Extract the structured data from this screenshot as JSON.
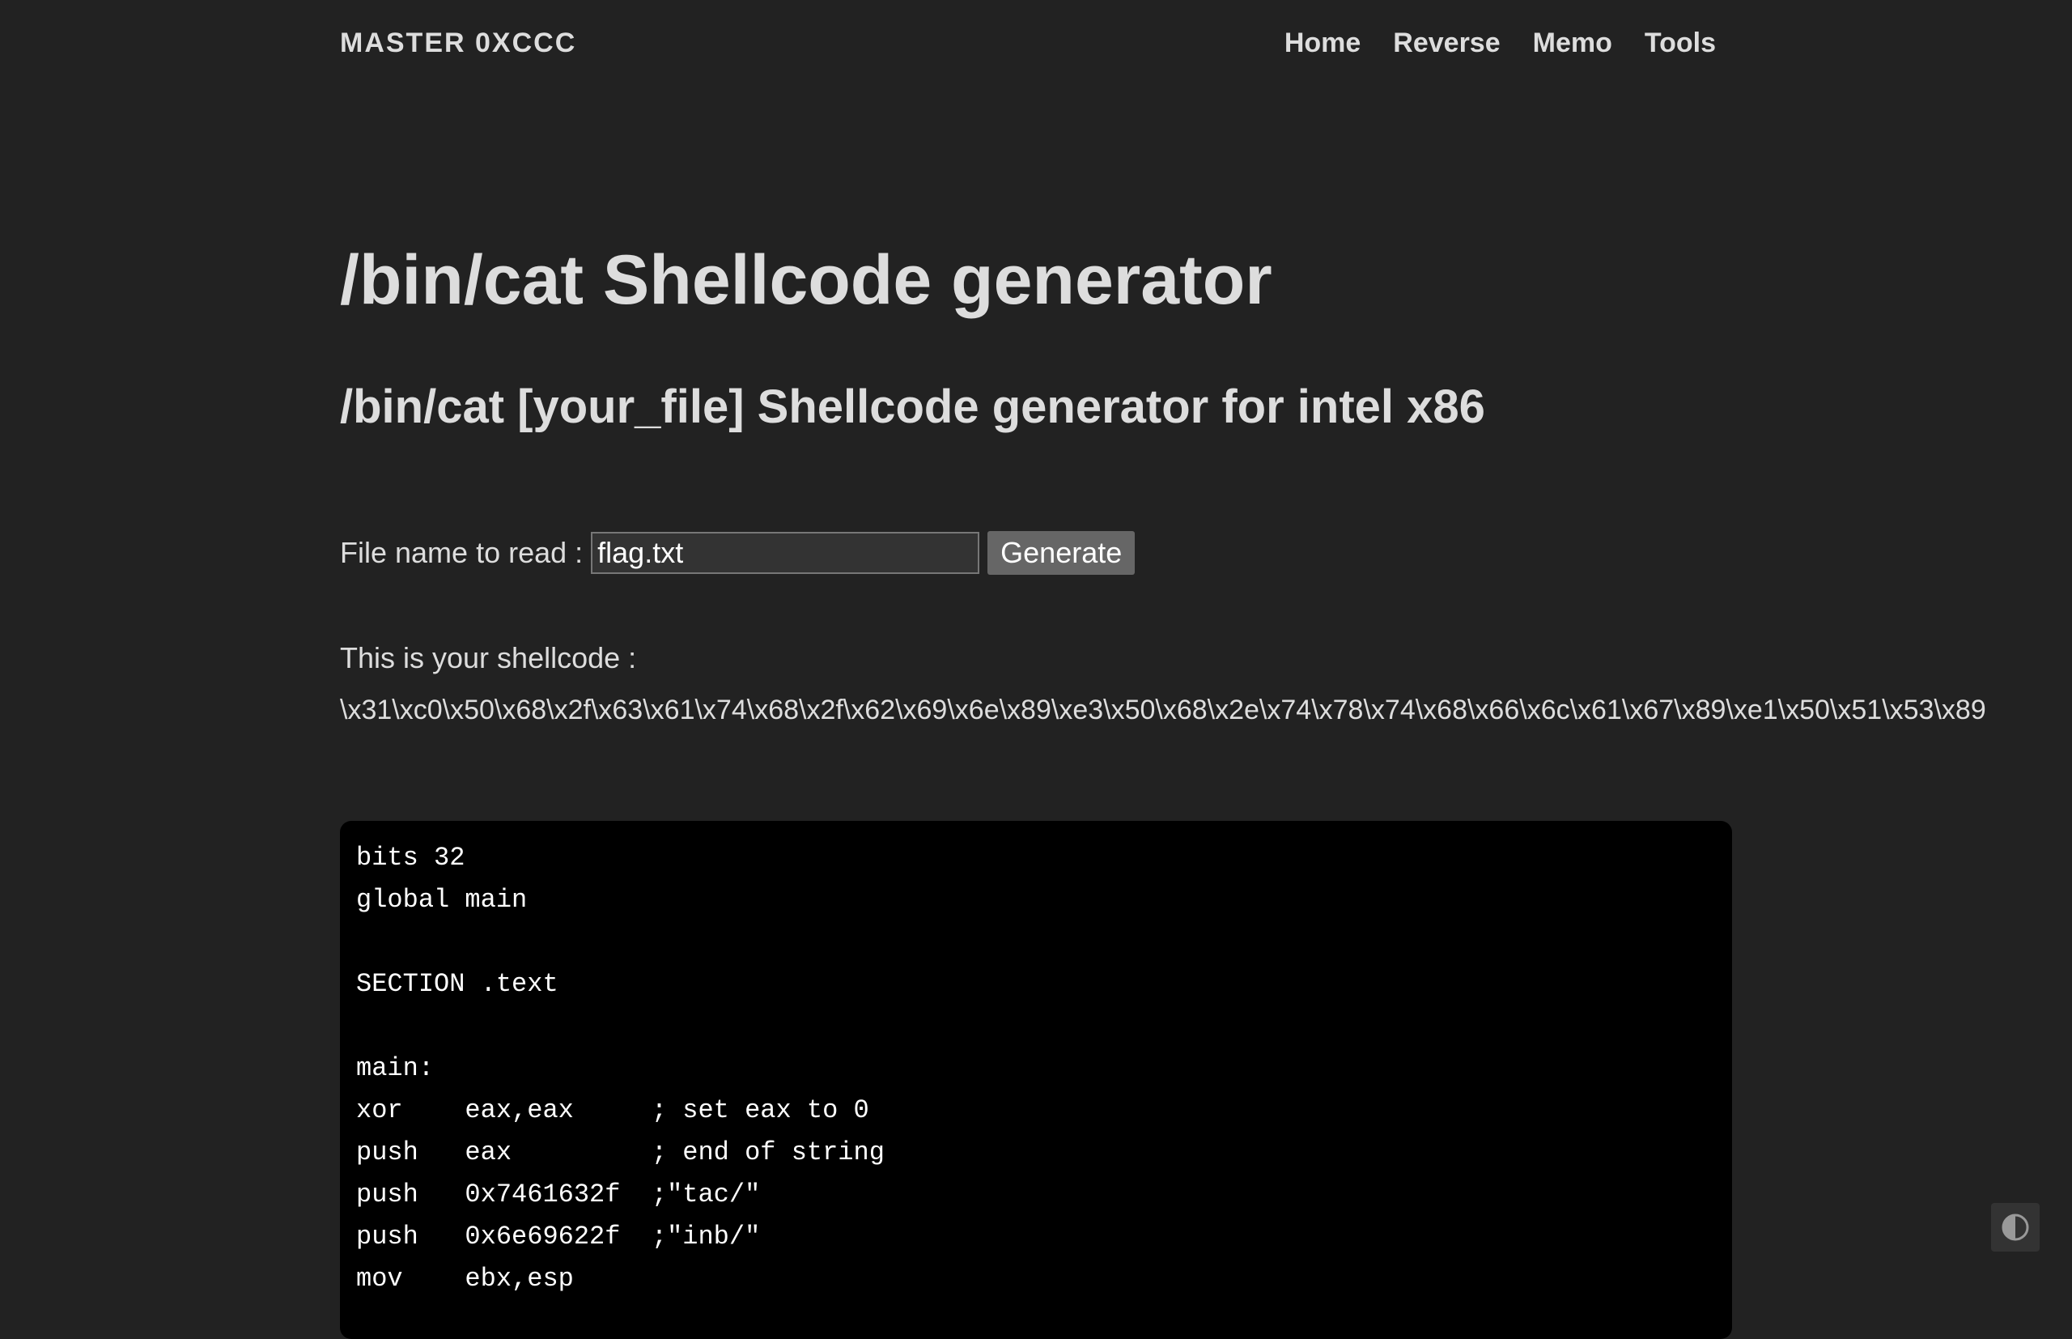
{
  "header": {
    "site_title": "MASTER 0XCCC",
    "nav": [
      {
        "label": "Home"
      },
      {
        "label": "Reverse"
      },
      {
        "label": "Memo"
      },
      {
        "label": "Tools"
      }
    ]
  },
  "main": {
    "title": "/bin/cat Shellcode generator",
    "subtitle": "/bin/cat [your_file] Shellcode generator for intel x86",
    "form": {
      "label": "File name to read :",
      "input_value": "flag.txt",
      "button_label": "Generate"
    },
    "shellcode_label": "This is your shellcode :",
    "shellcode": "\\x31\\xc0\\x50\\x68\\x2f\\x63\\x61\\x74\\x68\\x2f\\x62\\x69\\x6e\\x89\\xe3\\x50\\x68\\x2e\\x74\\x78\\x74\\x68\\x66\\x6c\\x61\\x67\\x89\\xe1\\x50\\x51\\x53\\x89",
    "code_lines": [
      "bits 32",
      "global main",
      "",
      "SECTION .text",
      "",
      "main:",
      "xor    eax,eax     ; set eax to 0",
      "push   eax         ; end of string",
      "push   0x7461632f  ;\"tac/\"",
      "push   0x6e69622f  ;\"inb/\"",
      "mov    ebx,esp"
    ]
  },
  "theme_toggle": {
    "icon": "contrast-icon"
  },
  "colors": {
    "background": "#222222",
    "text": "#dddddd",
    "code_background": "#000000",
    "button": "#666666"
  }
}
